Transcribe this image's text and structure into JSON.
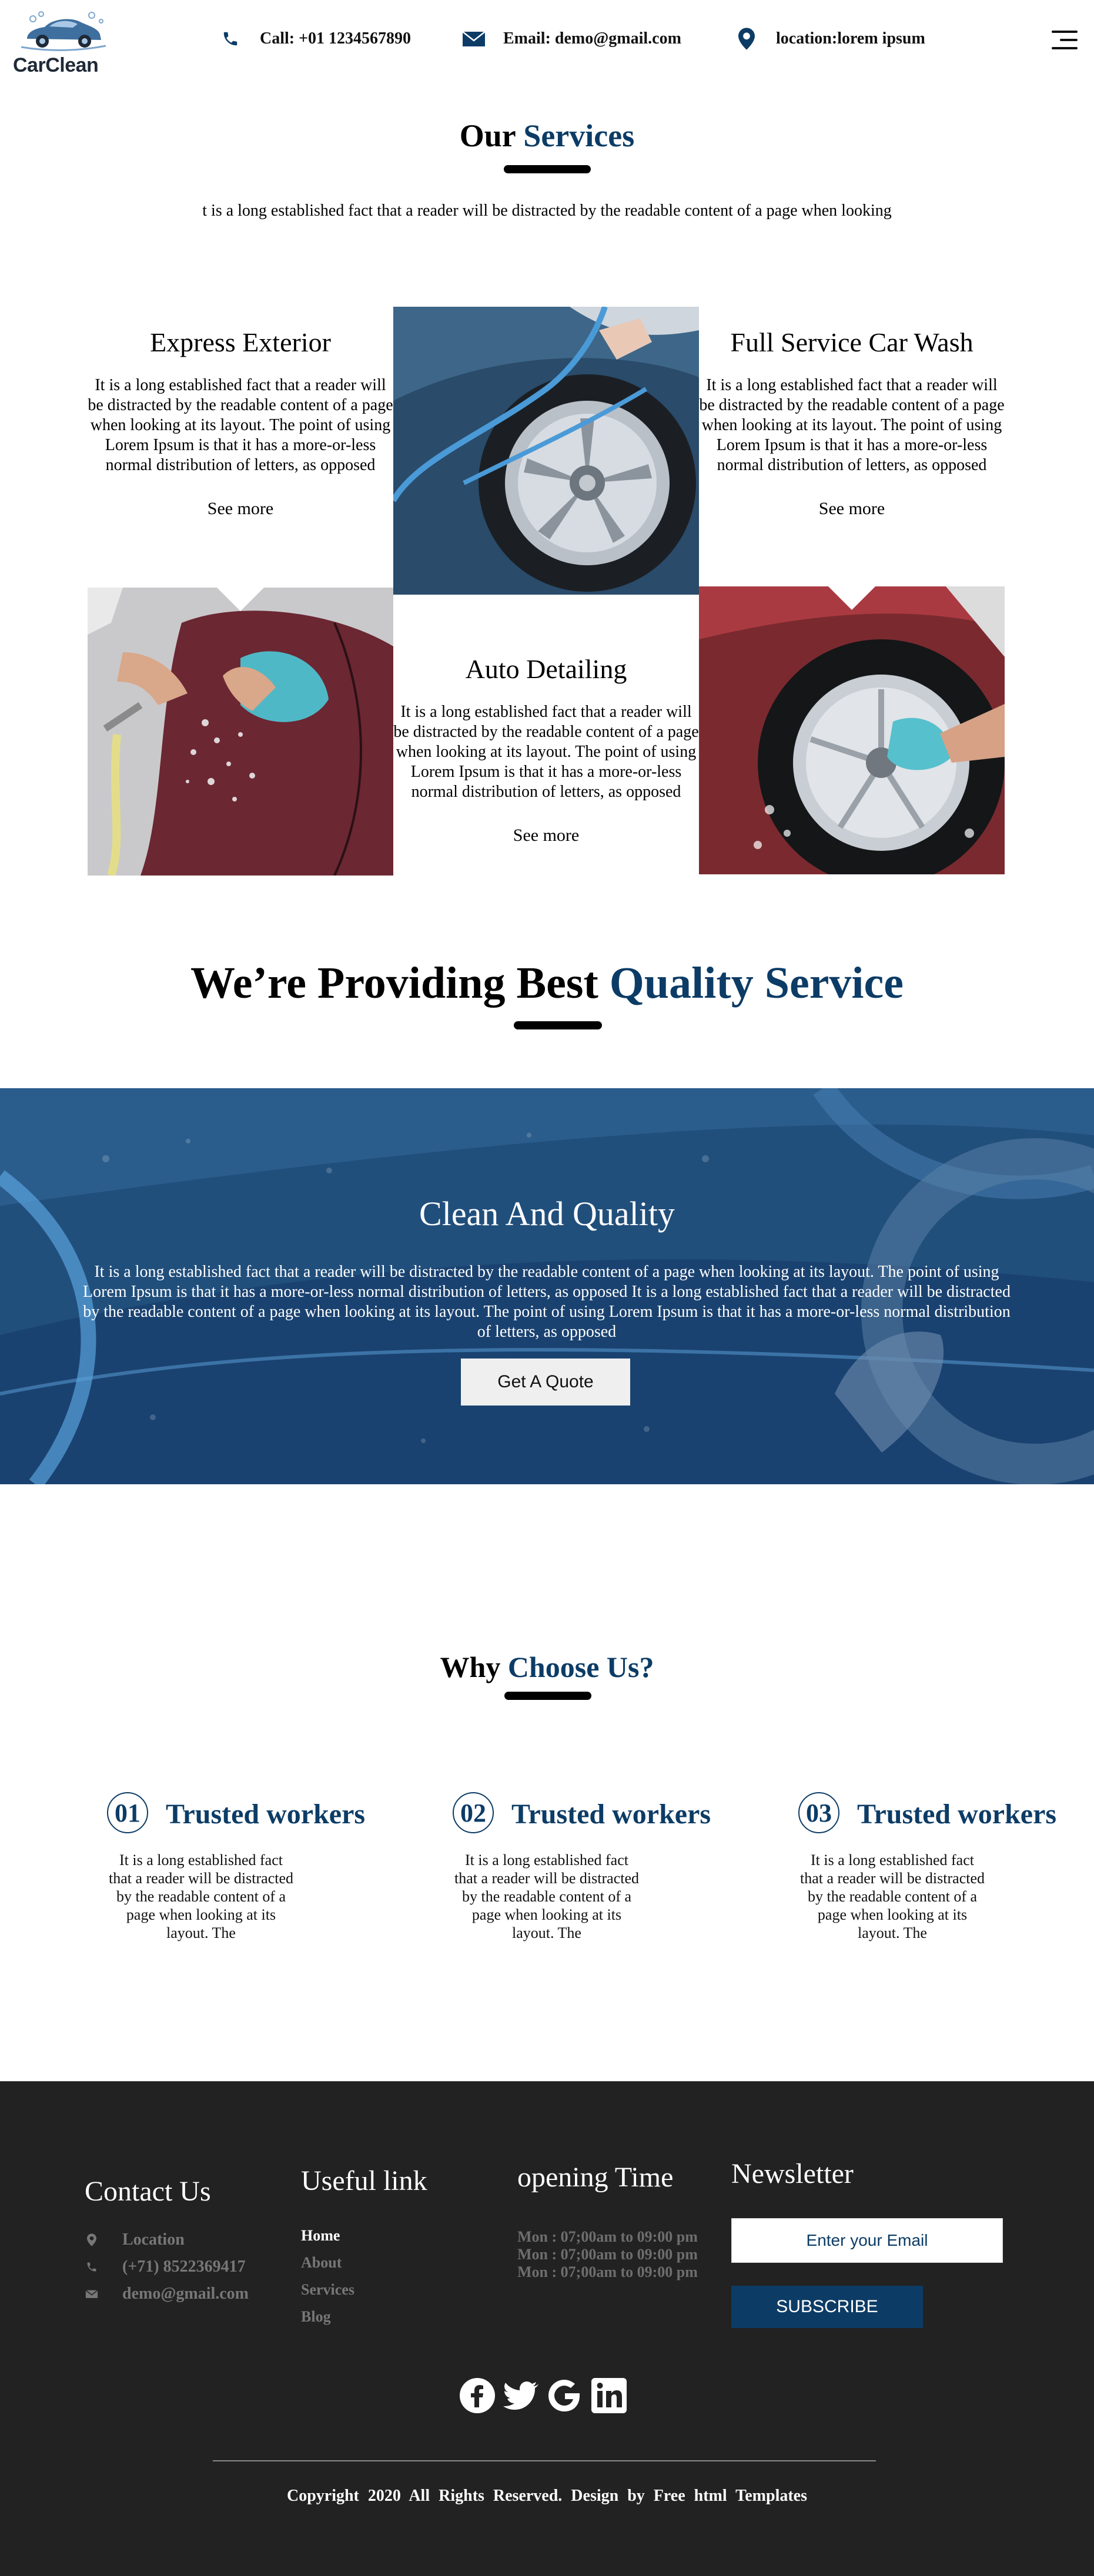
{
  "header": {
    "logo_text": "CarClean",
    "call": "Call: +01 1234567890",
    "email": "Email: demo@gmail.com",
    "location": "location:lorem ipsum"
  },
  "services": {
    "title_plain": "Our",
    "title_accent": "Services",
    "intro": "t is a long established fact that a reader will be distracted by the readable content of a page when looking",
    "items": [
      {
        "title": "Express Exterior",
        "text": "It is a long established fact that a reader will be distracted by the readable content of a page when looking at its layout. The point of using Lorem Ipsum is that it has a more-or-less normal distribution of letters, as opposed",
        "link": "See more"
      },
      {
        "title": "Full Service Car Wash",
        "text": "It is a long established fact that a reader will be distracted by the readable content of a page when looking at its layout. The point of using Lorem Ipsum is that it has a more-or-less normal distribution of letters, as opposed",
        "link": "See more"
      },
      {
        "title": "Auto Detailing",
        "text": "It is a long established fact that a reader will be distracted by the readable content of a page when looking at its layout. The point of using Lorem Ipsum is that it has a more-or-less normal distribution of letters, as opposed",
        "link": "See more"
      }
    ]
  },
  "quality": {
    "title_plain": "We’re Providing Best",
    "title_accent": "Quality Service"
  },
  "banner": {
    "title": "Clean And Quality",
    "text": "It is a long established fact that a reader will be distracted by the readable content of a page when looking at its layout. The point of using Lorem Ipsum is that it has a more-or-less normal distribution of letters, as opposed It is a long established fact that a reader will be distracted by the readable content of a page when looking at its layout. The point of using Lorem Ipsum is that it has a more-or-less normal distribution of letters, as opposed",
    "button": "Get A Quote"
  },
  "why": {
    "title_plain": "Why",
    "title_accent": "Choose Us?",
    "items": [
      {
        "num": "01",
        "title": "Trusted workers",
        "text": "It is a long established fact that a reader will be distracted by the readable content of a page when looking at its layout. The"
      },
      {
        "num": "02",
        "title": "Trusted workers",
        "text": "It is a long established fact that a reader will be distracted by the readable content of a page when looking at its layout. The"
      },
      {
        "num": "03",
        "title": "Trusted workers",
        "text": "It is a long established fact that a reader will be distracted by the readable content of a page when looking at its layout. The"
      }
    ]
  },
  "footer": {
    "contact": {
      "heading": "Contact Us",
      "location": "Location",
      "phone": "(+71) 8522369417",
      "email": "demo@gmail.com"
    },
    "links": {
      "heading": "Useful link",
      "items": [
        "Home",
        "About",
        "Services",
        "Blog"
      ]
    },
    "opening": {
      "heading": "opening Time",
      "items": [
        "Mon : 07;00am to 09:00 pm",
        "Mon : 07;00am to 09:00 pm",
        "Mon : 07;00am to 09:00 pm"
      ]
    },
    "newsletter": {
      "heading": "Newsletter",
      "placeholder": "Enter your Email",
      "button": "SUBSCRIBE"
    },
    "social_icons": [
      "facebook-icon",
      "twitter-icon",
      "google-icon",
      "linkedin-icon"
    ],
    "copyright": "Copyright 2020 All Rights Reserved. Design by Free html Templates"
  },
  "colors": {
    "accent": "#0c3c66",
    "banner": "#214f7c",
    "footer_bg": "#222222"
  }
}
